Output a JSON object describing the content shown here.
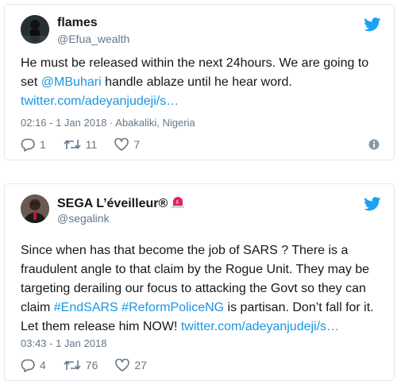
{
  "tweets": [
    {
      "name": "flames",
      "handle": "@Efua_wealth",
      "text_before": "He must be released within the next 24hours. We are going to set ",
      "mention": "@MBuhari",
      "text_after": " handle ablaze until he hear word.",
      "link": "twitter.com/adeyanjudeji/s…",
      "timestamp": "02:16 - 1 Jan 2018",
      "location": "Abakaliki, Nigeria",
      "replies": "1",
      "retweets": "11",
      "likes": "7"
    },
    {
      "name": "SEGA L’éveilleur®",
      "handle": "@segalink",
      "text_before": "Since when has that become the job of SARS ? There is a fraudulent angle to that claim by the Rogue Unit. They may be targeting derailing our focus to attacking the Govt so they can claim ",
      "hashtag1": "#EndSARS",
      "hashtag2": "#ReformPoliceNG",
      "text_after": " is partisan. Don’t fall for it. Let them release him NOW! ",
      "link": "twitter.com/adeyanjudeji/s…",
      "timestamp": "03:43 - 1 Jan 2018",
      "replies": "4",
      "retweets": "76",
      "likes": "27"
    }
  ],
  "colors": {
    "twitter_blue": "#1da1f2",
    "link": "#1b95e0",
    "muted": "#657786",
    "siren_red": "#e0245e"
  },
  "icons": [
    "twitter-bird-icon",
    "reply-icon",
    "retweet-icon",
    "like-icon",
    "info-icon",
    "police-light-icon"
  ]
}
